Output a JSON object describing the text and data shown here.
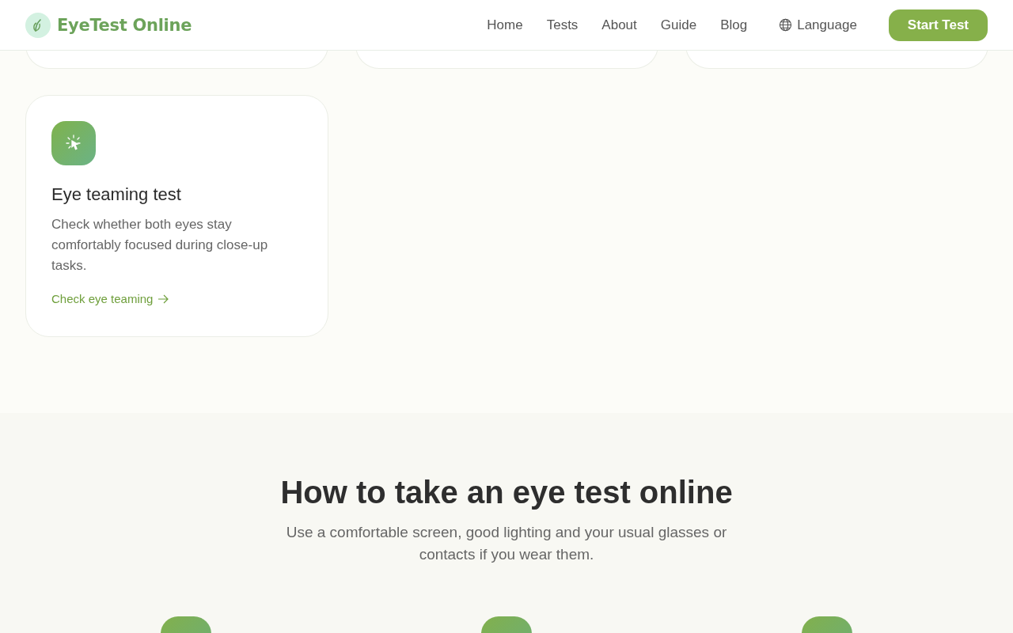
{
  "header": {
    "logo": "EyeTest Online",
    "nav": [
      "Home",
      "Tests",
      "About",
      "Guide",
      "Blog"
    ],
    "language": "Language",
    "cta": "Start Test"
  },
  "card": {
    "title": "Eye teaming test",
    "description": "Check whether both eyes stay comfortably focused during close-up tasks.",
    "link": "Check eye teaming"
  },
  "how_to": {
    "title": "How to take an eye test online",
    "subtitle": "Use a comfortable screen, good lighting and your usual glasses or contacts if you wear them."
  }
}
